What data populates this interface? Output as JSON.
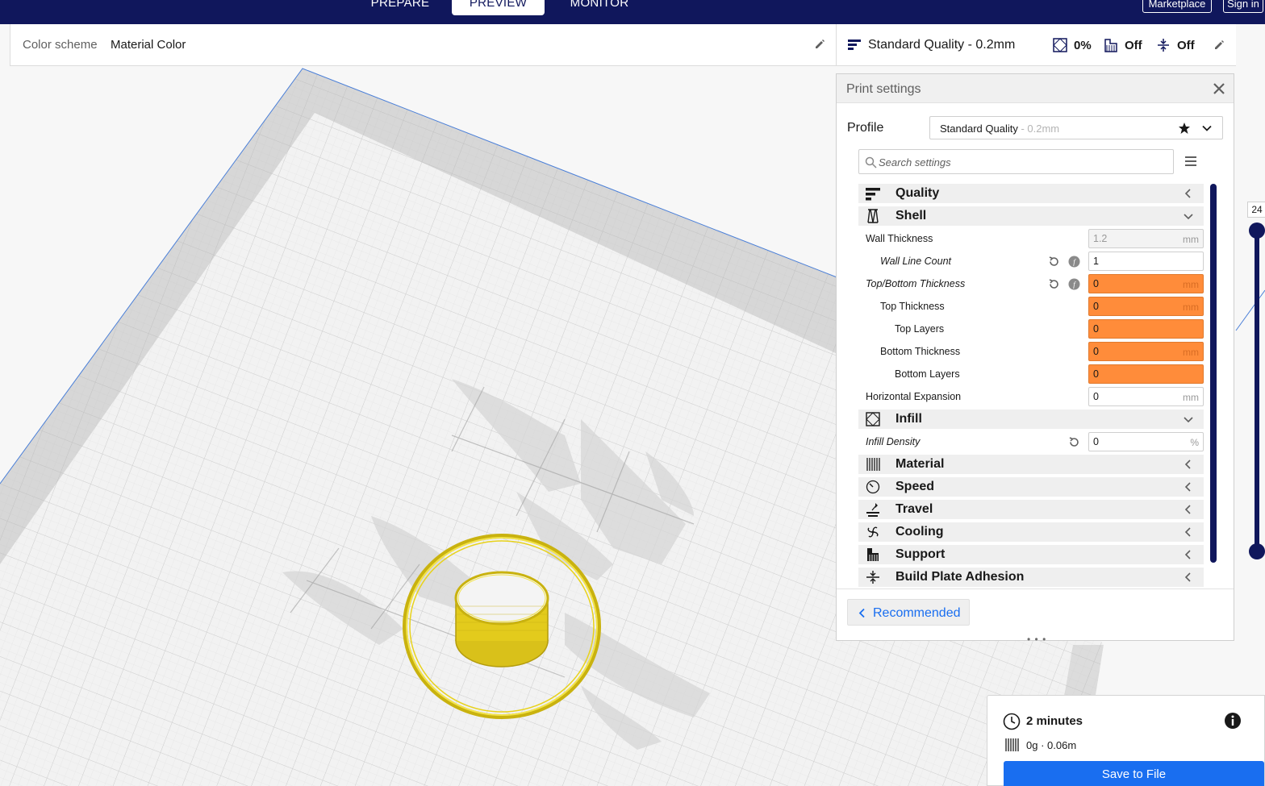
{
  "topbar": {
    "tabs": [
      {
        "label": "PREPARE",
        "active": false
      },
      {
        "label": "PREVIEW",
        "active": true
      },
      {
        "label": "MONITOR",
        "active": false
      }
    ],
    "marketplace": "Marketplace",
    "signin": "Sign in"
  },
  "colorscheme": {
    "label": "Color scheme",
    "value": "Material Color",
    "edit_icon": "pencil-icon"
  },
  "printsetup": {
    "quality": "Standard Quality - 0.2mm",
    "infill": "0%",
    "support": "Off",
    "adhesion": "Off"
  },
  "panel": {
    "title": "Print settings",
    "profile_label": "Profile",
    "profile_name": "Standard Quality",
    "profile_layer": " - 0.2mm",
    "search_placeholder": "Search settings",
    "categories": {
      "quality": "Quality",
      "shell": "Shell",
      "infill": "Infill",
      "material": "Material",
      "speed": "Speed",
      "travel": "Travel",
      "cooling": "Cooling",
      "support": "Support",
      "adhesion": "Build Plate Adhesion"
    },
    "settings": {
      "wall_thickness": {
        "label": "Wall Thickness",
        "value": "1.2",
        "unit": "mm"
      },
      "wall_line_count": {
        "label": "Wall Line Count",
        "value": "1"
      },
      "top_bottom_thickness": {
        "label": "Top/Bottom Thickness",
        "value": "0",
        "unit": "mm"
      },
      "top_thickness": {
        "label": "Top Thickness",
        "value": "0",
        "unit": "mm"
      },
      "top_layers": {
        "label": "Top Layers",
        "value": "0"
      },
      "bottom_thickness": {
        "label": "Bottom Thickness",
        "value": "0",
        "unit": "mm"
      },
      "bottom_layers": {
        "label": "Bottom Layers",
        "value": "0"
      },
      "horizontal_expansion": {
        "label": "Horizontal Expansion",
        "value": "0",
        "unit": "mm"
      },
      "infill_density": {
        "label": "Infill Density",
        "value": "0",
        "unit": "%"
      }
    },
    "recommended": "Recommended"
  },
  "layer_slider": {
    "value": "24"
  },
  "action": {
    "time": "2 minutes",
    "material": "0g · 0.06m",
    "save": "Save to File"
  },
  "colors": {
    "navy": "#10175c",
    "accent_blue": "#196ef0",
    "error_orange": "#ff8c3a",
    "print_yellow": "#e8d21a"
  }
}
